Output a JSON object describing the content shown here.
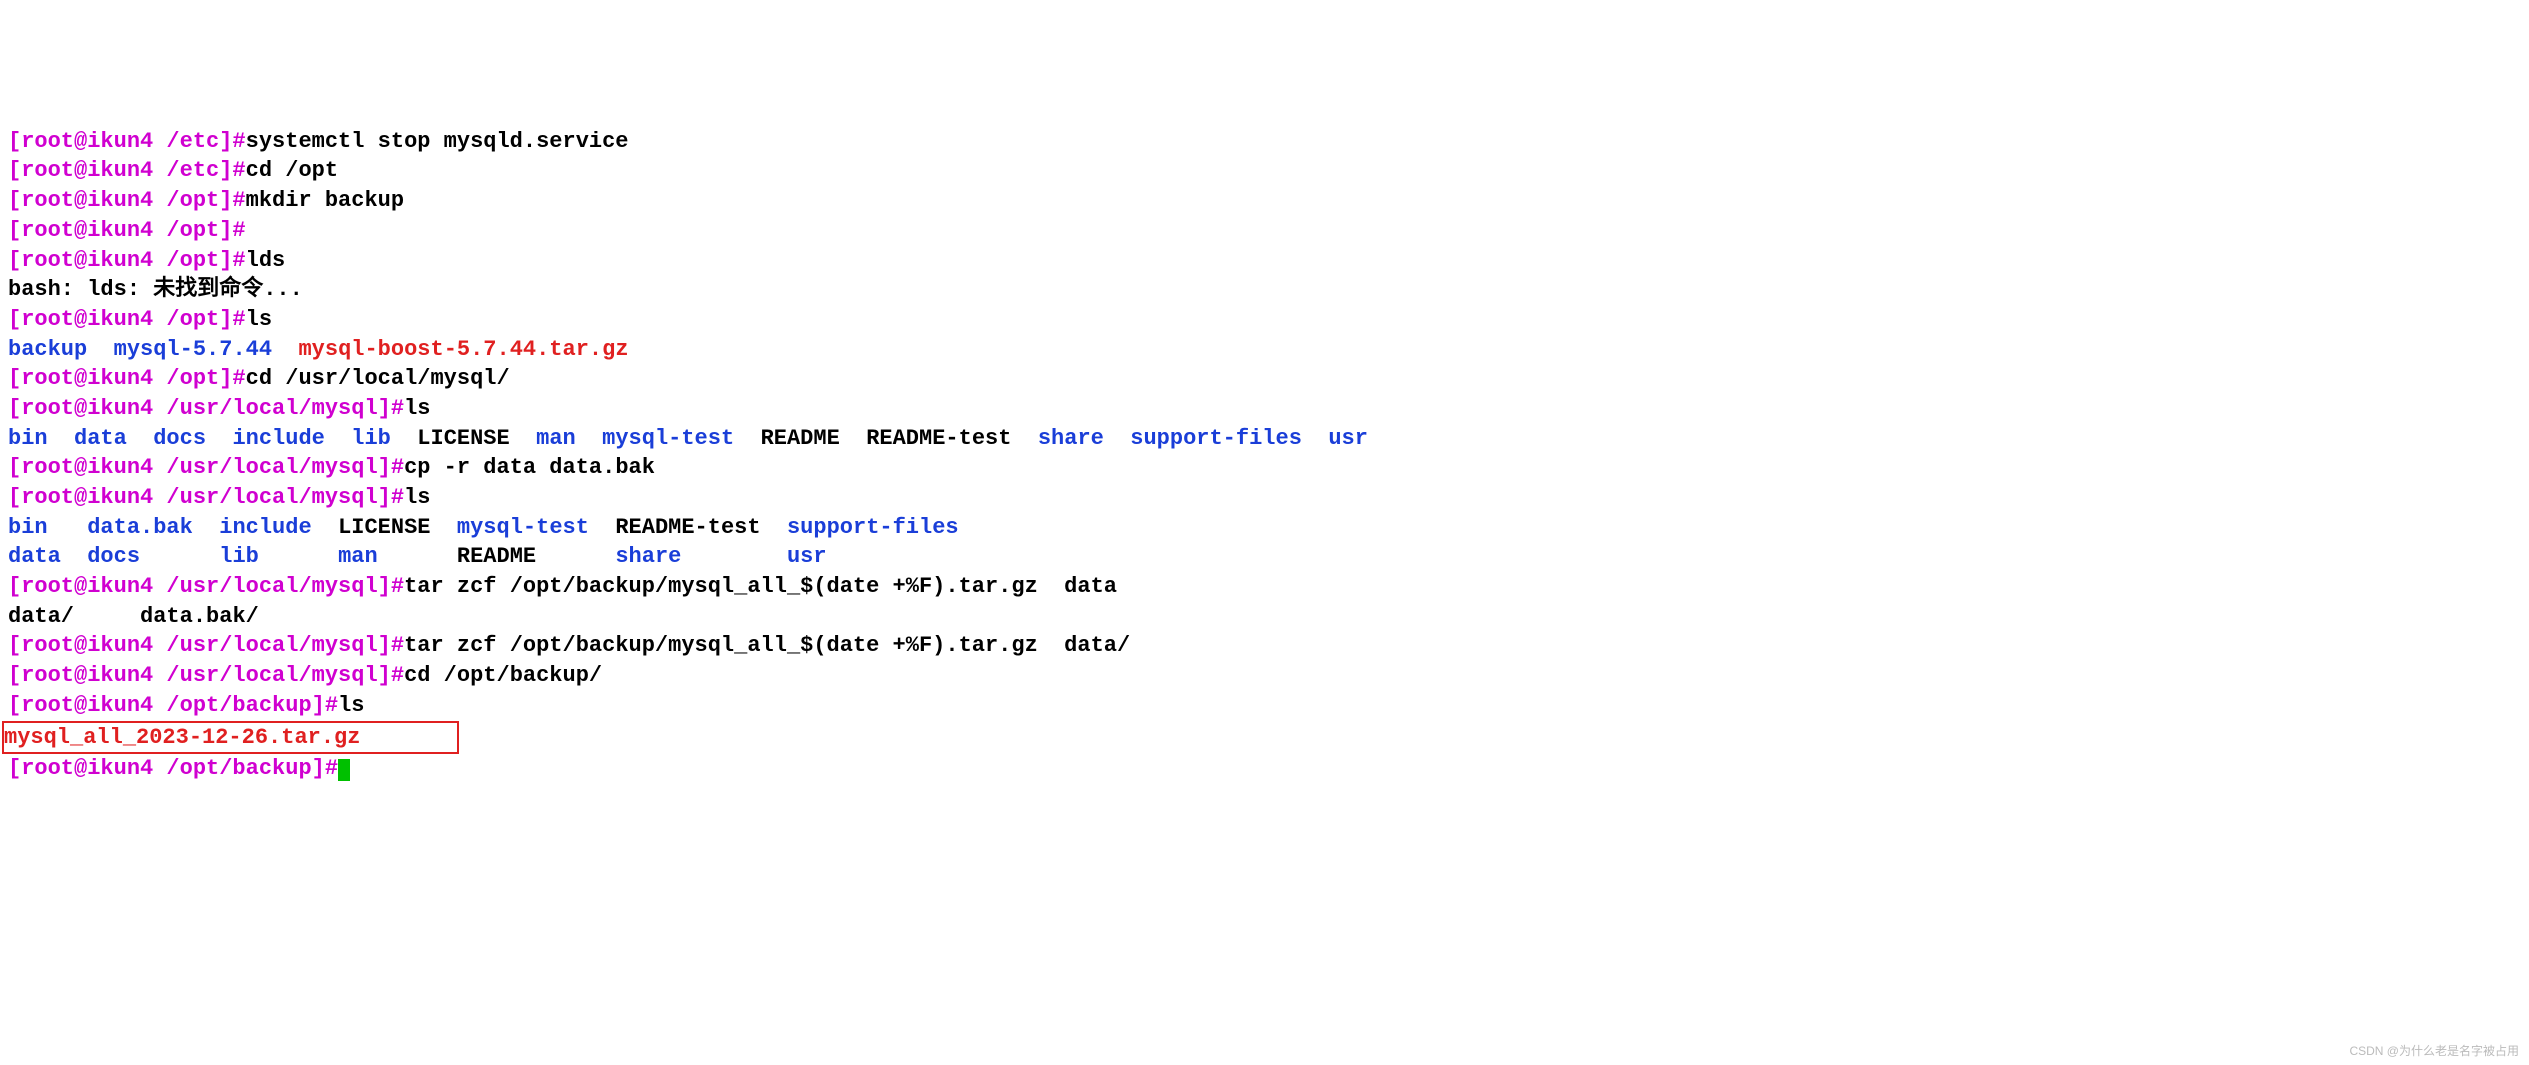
{
  "prompts": {
    "etc": "[root@ikun4 /etc]#",
    "opt": "[root@ikun4 /opt]#",
    "mysql": "[root@ikun4 /usr/local/mysql]#",
    "backup": "[root@ikun4 /opt/backup]#"
  },
  "cmds": {
    "c1": "systemctl stop mysqld.service",
    "c2": "cd /opt",
    "c3": "mkdir backup",
    "c4": "",
    "c5": "lds",
    "c6": "ls",
    "c7": "cd /usr/local/mysql/",
    "c8": "ls",
    "c9": "cp -r data data.bak",
    "c10": "ls",
    "c11": "tar zcf /opt/backup/mysql_all_$(date +%F).tar.gz  data",
    "c12": "tar zcf /opt/backup/mysql_all_$(date +%F).tar.gz  data/",
    "c13": "cd /opt/backup/",
    "c14": "ls"
  },
  "out": {
    "bash_err": "bash: lds: 未找到命令...",
    "ls_opt": {
      "backup": "backup",
      "mysql574": "mysql-5.7.44",
      "boost": "mysql-boost-5.7.44.tar.gz"
    },
    "ls_mysql1": {
      "bin": "bin",
      "data": "data",
      "docs": "docs",
      "include": "include",
      "lib": "lib",
      "license": "LICENSE",
      "man": "man",
      "mysqltest": "mysql-test",
      "readme": "README",
      "readmetest": "README-test",
      "share": "share",
      "supportfiles": "support-files",
      "usr": "usr"
    },
    "ls_mysql2_r1": {
      "bin": "bin",
      "databak": "data.bak",
      "include": "include",
      "license": "LICENSE",
      "mysqltest": "mysql-test",
      "readmetest": "README-test",
      "supportfiles": "support-files"
    },
    "ls_mysql2_r2": {
      "data": "data",
      "docs": "docs",
      "lib": "lib",
      "man": "man",
      "readme": "README",
      "share": "share",
      "usr": "usr"
    },
    "tab_complete": {
      "data": "data/",
      "databak": "data.bak/"
    },
    "ls_backup": "mysql_all_2023-12-26.tar.gz"
  },
  "watermark": "CSDN @为什么老是名字被占用"
}
